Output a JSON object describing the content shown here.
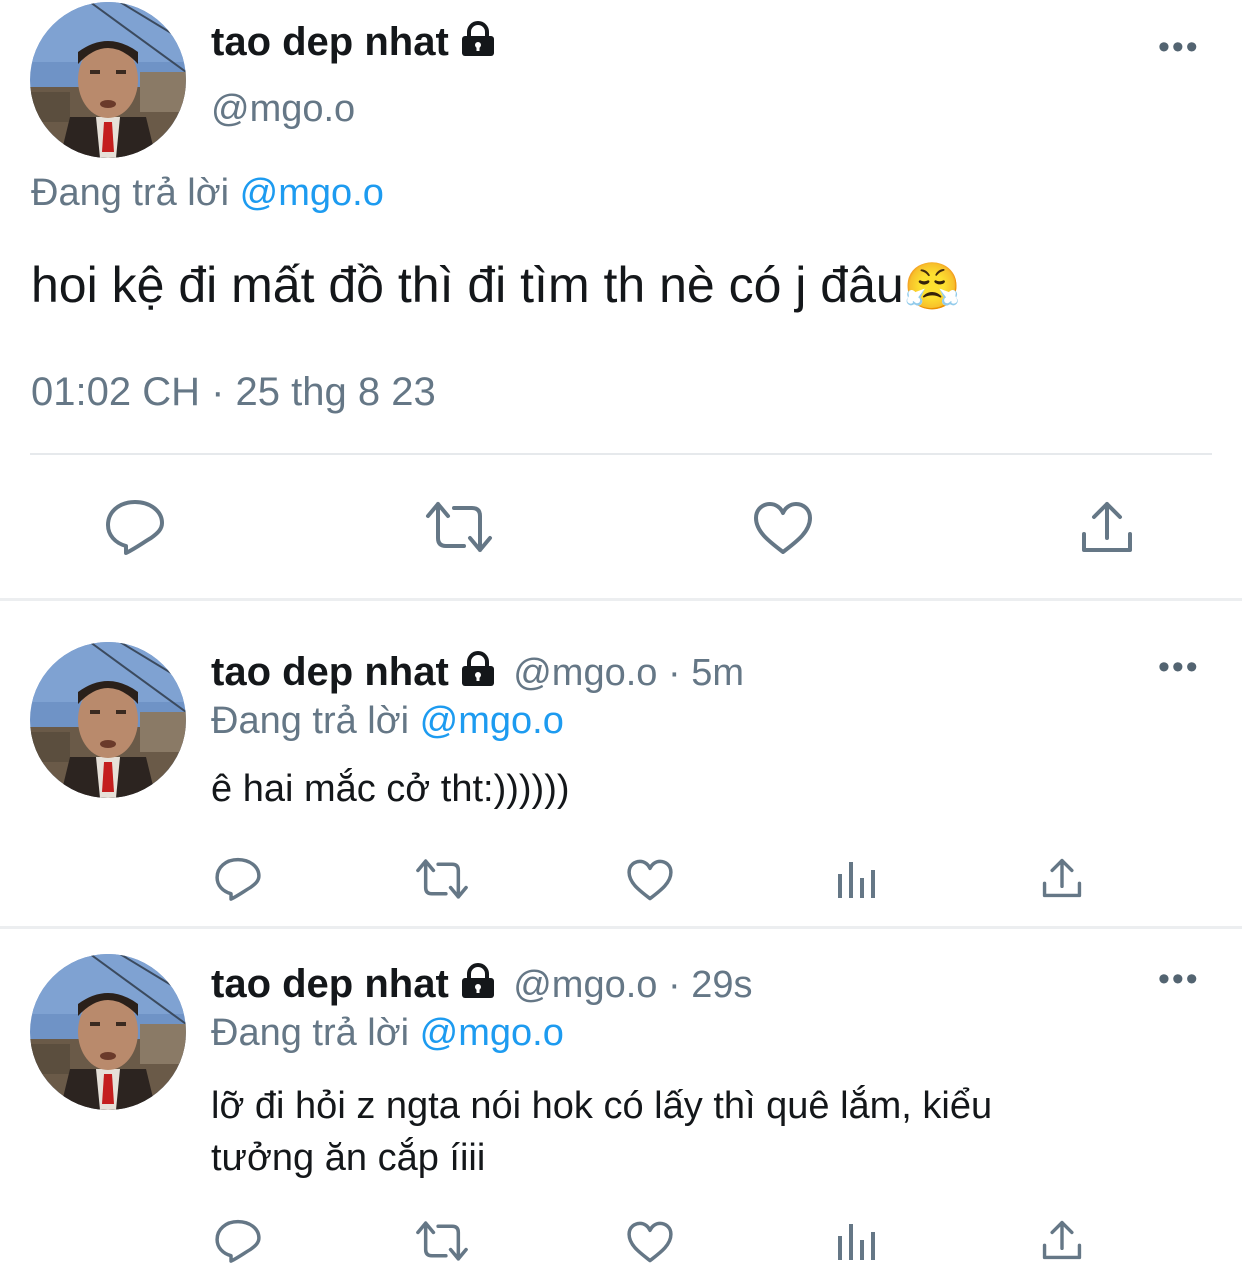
{
  "main_tweet": {
    "display_name": "tao dep nhat",
    "handle": "@mgo.o",
    "reply_prefix": "Đang trả lời",
    "reply_mention": "@mgo.o",
    "text": "hoi kệ đi mất đồ thì đi tìm th nè có j đâu",
    "emoji": "😤",
    "timestamp": "01:02 CH · 25 thg 8 23",
    "icons": [
      "reply-icon",
      "retweet-icon",
      "like-icon",
      "share-icon"
    ]
  },
  "replies": [
    {
      "display_name": "tao dep nhat",
      "handle_time": "@mgo.o · 5m",
      "reply_prefix": "Đang trả lời",
      "reply_mention": "@mgo.o",
      "text_lines": [
        "ê hai mắc cở tht:))))))"
      ]
    },
    {
      "display_name": "tao dep nhat",
      "handle_time": "@mgo.o · 29s",
      "reply_prefix": "Đang trả lời",
      "reply_mention": "@mgo.o",
      "text_lines": [
        "lỡ đi hỏi z ngta nói hok có lấy thì quê lắm, kiểu",
        "tưởng ăn cắp íiii"
      ]
    }
  ],
  "colors": {
    "accent": "#1d9bf0",
    "secondary_text": "#657786",
    "icon": "#657786",
    "divider": "#eceef0"
  },
  "more_label": "•••"
}
